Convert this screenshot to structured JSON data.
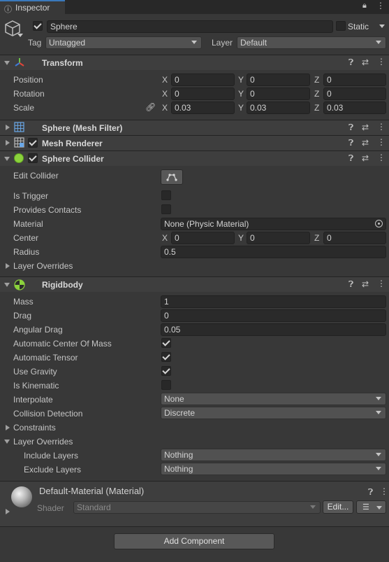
{
  "tab": {
    "title": "Inspector",
    "icon": "info-icon"
  },
  "object": {
    "name": "Sphere",
    "static_label": "Static",
    "tag_label": "Tag",
    "tag_value": "Untagged",
    "layer_label": "Layer",
    "layer_value": "Default"
  },
  "transform": {
    "title": "Transform",
    "position": {
      "label": "Position",
      "x": "0",
      "y": "0",
      "z": "0"
    },
    "rotation": {
      "label": "Rotation",
      "x": "0",
      "y": "0",
      "z": "0"
    },
    "scale": {
      "label": "Scale",
      "x": "0.03",
      "y": "0.03",
      "z": "0.03"
    },
    "axes": {
      "x": "X",
      "y": "Y",
      "z": "Z"
    }
  },
  "mesh_filter": {
    "title": "Sphere (Mesh Filter)"
  },
  "mesh_renderer": {
    "title": "Mesh Renderer"
  },
  "sphere_collider": {
    "title": "Sphere Collider",
    "edit_collider": "Edit Collider",
    "is_trigger": "Is Trigger",
    "provides_contacts": "Provides Contacts",
    "material_label": "Material",
    "material_value": "None (Physic Material)",
    "center_label": "Center",
    "center": {
      "x": "0",
      "y": "0",
      "z": "0"
    },
    "radius_label": "Radius",
    "radius_value": "0.5",
    "layer_overrides": "Layer Overrides"
  },
  "rigidbody": {
    "title": "Rigidbody",
    "mass_label": "Mass",
    "mass": "1",
    "drag_label": "Drag",
    "drag": "0",
    "angular_drag_label": "Angular Drag",
    "angular_drag": "0.05",
    "auto_com": "Automatic Center Of Mass",
    "auto_tensor": "Automatic Tensor",
    "use_gravity": "Use Gravity",
    "is_kinematic": "Is Kinematic",
    "interpolate_label": "Interpolate",
    "interpolate": "None",
    "collision_label": "Collision Detection",
    "collision": "Discrete",
    "constraints": "Constraints",
    "layer_overrides": "Layer Overrides",
    "include_label": "Include Layers",
    "include": "Nothing",
    "exclude_label": "Exclude Layers",
    "exclude": "Nothing"
  },
  "material": {
    "title": "Default-Material (Material)",
    "shader_label": "Shader",
    "shader_value": "Standard",
    "edit_button": "Edit..."
  },
  "add_component": "Add Component"
}
